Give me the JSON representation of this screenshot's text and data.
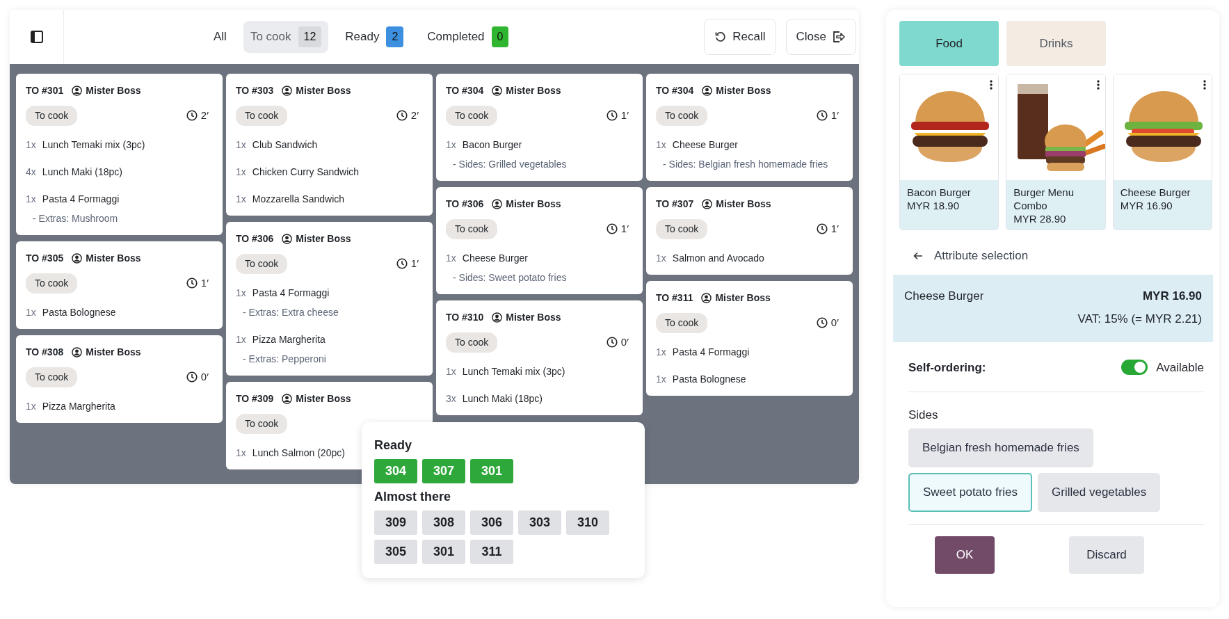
{
  "toolbar": {
    "filters": [
      {
        "label": "All",
        "selected": false
      },
      {
        "label": "To cook",
        "count": "12",
        "selected": true,
        "color": "#d9dadd"
      },
      {
        "label": "Ready",
        "count": "2",
        "selected": false,
        "color": "#3d8fe0"
      },
      {
        "label": "Completed",
        "count": "0",
        "selected": false,
        "color": "#2fb52f"
      }
    ],
    "actions": [
      {
        "label": "Recall",
        "kind": "recall"
      },
      {
        "label": "Close",
        "kind": "exit"
      }
    ]
  },
  "columns": [
    {
      "tickets": [
        {
          "number": "TO #301",
          "customer": "Mister Boss",
          "status": "To cook",
          "time": "2′",
          "items": [
            {
              "qty": "1x",
              "name": "Lunch Temaki mix (3pc)"
            },
            {
              "qty": "4x",
              "name": "Lunch Maki (18pc)"
            },
            {
              "qty": "1x",
              "name": "Pasta 4 Formaggi",
              "note": "- Extras:  Mushroom"
            }
          ]
        },
        {
          "number": "TO #305",
          "customer": "Mister Boss",
          "status": "To cook",
          "time": "1′",
          "items": [
            {
              "qty": "1x",
              "name": "Pasta Bolognese"
            }
          ]
        },
        {
          "number": "TO #308",
          "customer": "Mister Boss",
          "status": "To cook",
          "time": "0′",
          "items": [
            {
              "qty": "1x",
              "name": "Pizza Margherita"
            }
          ]
        }
      ]
    },
    {
      "tickets": [
        {
          "number": "TO #303",
          "customer": "Mister Boss",
          "status": "To cook",
          "time": "2′",
          "items": [
            {
              "qty": "1x",
              "name": "Club Sandwich"
            },
            {
              "qty": "1x",
              "name": "Chicken Curry Sandwich"
            },
            {
              "qty": "1x",
              "name": "Mozzarella Sandwich"
            }
          ]
        },
        {
          "number": "TO #306",
          "customer": "Mister Boss",
          "status": "To cook",
          "time": "1′",
          "items": [
            {
              "qty": "1x",
              "name": "Pasta 4 Formaggi",
              "note": "- Extras:  Extra cheese"
            },
            {
              "qty": "1x",
              "name": "Pizza Margherita",
              "note": "- Extras:  Pepperoni"
            }
          ]
        },
        {
          "number": "TO #309",
          "customer": "Mister Boss",
          "status": "To cook",
          "items": [
            {
              "qty": "1x",
              "name": "Lunch Salmon (20pc)"
            }
          ]
        }
      ]
    },
    {
      "tickets": [
        {
          "number": "TO #304",
          "customer": "Mister Boss",
          "status": "To cook",
          "time": "1′",
          "items": [
            {
              "qty": "1x",
              "name": "Bacon Burger",
              "note": "- Sides:  Grilled vegetables"
            }
          ]
        },
        {
          "number": "TO #306",
          "customer": "Mister Boss",
          "status": "To cook",
          "time": "1′",
          "items": [
            {
              "qty": "1x",
              "name": "Cheese Burger",
              "note": "- Sides:  Sweet potato fries"
            }
          ]
        },
        {
          "number": "TO #310",
          "customer": "Mister Boss",
          "status": "To cook",
          "time": "0′",
          "items": [
            {
              "qty": "1x",
              "name": "Lunch Temaki mix (3pc)"
            },
            {
              "qty": "3x",
              "name": "Lunch Maki (18pc)"
            }
          ]
        }
      ]
    },
    {
      "tickets": [
        {
          "number": "TO #304",
          "customer": "Mister Boss",
          "status": "To cook",
          "time": "1′",
          "items": [
            {
              "qty": "1x",
              "name": "Cheese Burger",
              "note": "- Sides:  Belgian fresh homemade fries"
            }
          ]
        },
        {
          "number": "TO #307",
          "customer": "Mister Boss",
          "status": "To cook",
          "time": "1′",
          "items": [
            {
              "qty": "1x",
              "name": "Salmon and Avocado"
            }
          ]
        },
        {
          "number": "TO #311",
          "customer": "Mister Boss",
          "status": "To cook",
          "time": "0′",
          "items": [
            {
              "qty": "1x",
              "name": "Pasta 4 Formaggi"
            },
            {
              "qty": "1x",
              "name": "Pasta Bolognese"
            }
          ]
        }
      ]
    }
  ],
  "order_status_popup": {
    "groups": [
      {
        "title": "Ready",
        "kind": "ready",
        "orders": [
          "304",
          "307",
          "301"
        ]
      },
      {
        "title": "Almost there",
        "kind": "waiting",
        "orders": [
          "309",
          "308",
          "306",
          "303",
          "310",
          "305",
          "301",
          "311"
        ]
      }
    ]
  },
  "categories": [
    {
      "label": "Food",
      "selected": true,
      "color": "#7fd9cf"
    },
    {
      "label": "Drinks",
      "selected": false,
      "color": "#f4ebe3"
    }
  ],
  "products": [
    {
      "name": "Bacon Burger",
      "price": "MYR 18.90"
    },
    {
      "name": "Burger Menu Combo",
      "price": "MYR 28.90"
    },
    {
      "name": "Cheese Burger",
      "price": "MYR 16.90"
    }
  ],
  "attribute_selection": {
    "title": "Attribute selection",
    "product": "Cheese Burger",
    "price": "MYR 16.90",
    "vat": "VAT: 15% (= MYR 2.21)",
    "self_ordering": {
      "label": "Self-ordering:",
      "on": true,
      "state_label": "Available"
    },
    "attribute": {
      "label": "Sides",
      "options": [
        {
          "label": "Belgian fresh homemade fries",
          "selected": false
        },
        {
          "label": "Sweet potato fries",
          "selected": true
        },
        {
          "label": "Grilled vegetables",
          "selected": false
        }
      ]
    },
    "buttons": [
      {
        "label": "OK",
        "kind": "primary"
      },
      {
        "label": "Discard",
        "kind": "secondary"
      }
    ]
  }
}
